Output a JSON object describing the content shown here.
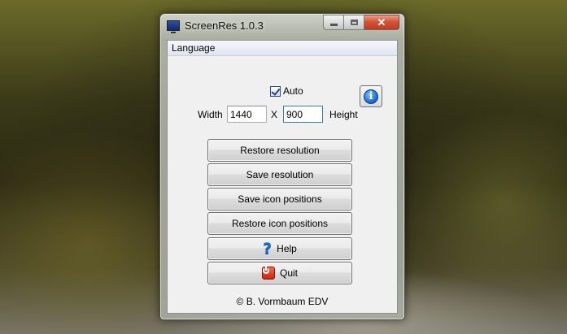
{
  "window": {
    "title": "ScreenRes 1.0.3",
    "close_glyph": "✕"
  },
  "menu": {
    "items": [
      "Language"
    ]
  },
  "auto": {
    "label": "Auto",
    "checked": true
  },
  "resolution": {
    "width_label": "Width",
    "width_value": "1440",
    "separator": "X",
    "height_value": "900",
    "height_label": "Height"
  },
  "info": {
    "glyph": "i",
    "icon": "info-icon"
  },
  "buttons": {
    "restore_resolution": "Restore resolution",
    "save_resolution": "Save resolution",
    "save_icon_positions": "Save icon positions",
    "restore_icon_positions": "Restore icon positions",
    "help": "Help",
    "help_glyph": "?",
    "quit": "Quit"
  },
  "footer": {
    "copyright": "© B. Vormbaum EDV"
  },
  "colors": {
    "close_button": "#c23a1e",
    "help_icon": "#1a6fd0",
    "quit_icon": "#c7250d",
    "info_icon": "#1463c8"
  }
}
